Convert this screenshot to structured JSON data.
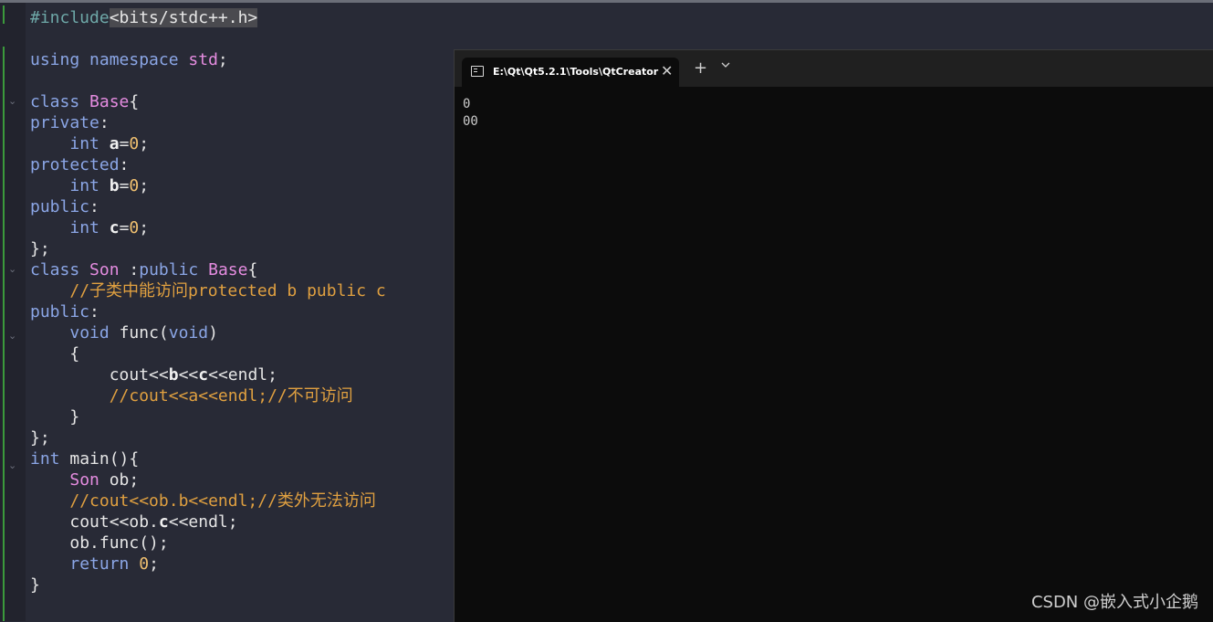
{
  "editor": {
    "code": {
      "l1_a": "#include",
      "l1_b": "<bits/stdc++.h>",
      "l3_kw": "using namespace",
      "l3_std": "std",
      "l3_semi": ";",
      "class_kw": "class",
      "base": "Base",
      "brace_open": "{",
      "private": "private",
      "protected": "protected",
      "public": "public",
      "colon": ":",
      "int": "int",
      "a": "a",
      "b": "b",
      "c": "c",
      "eq": "=",
      "zero": "0",
      "semi": ";",
      "close_semi": "};",
      "son": "Son",
      "inherit_colon": " :",
      "comment1": "//子类中能访问protected b public c",
      "void": "void",
      "func": "func",
      "paren_open": "(",
      "paren_close": ")",
      "cout_a": "cout<<",
      "lshift": "<<",
      "endl_semi": "<<endl;",
      "comment2": "//cout<<a<<endl;//不可访问",
      "rbrace": "}",
      "main": "main",
      "main_paren": "(){",
      "ob_semi": " ob;",
      "comment3": "//cout<<ob.b<<endl;//类外无法访问",
      "cout_ob": "cout<<ob.",
      "ob_func": "ob.func();",
      "return": "return"
    }
  },
  "terminal": {
    "tab_title": "E:\\Qt\\Qt5.2.1\\Tools\\QtCreator",
    "close_glyph": "✕",
    "new_tab_glyph": "+",
    "output": [
      "0",
      "00"
    ]
  },
  "watermark": "CSDN @嵌入式小企鹅"
}
